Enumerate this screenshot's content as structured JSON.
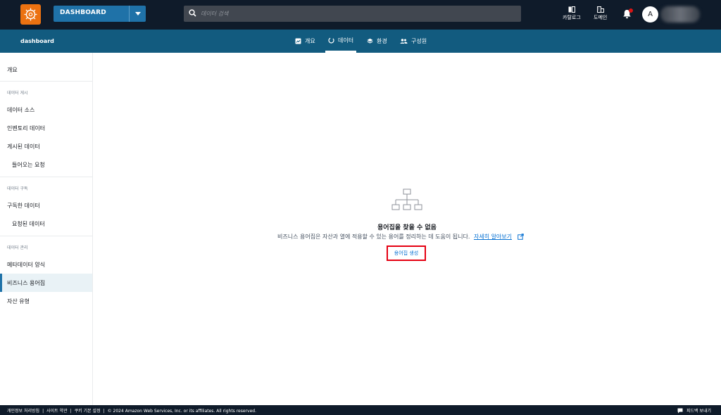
{
  "topbar": {
    "project_name": "DASHBOARD",
    "search_placeholder": "데이터 검색",
    "catalog_label": "카탈로그",
    "domain_label": "도메인",
    "avatar_initial": "A"
  },
  "subheader": {
    "project_title": "dashboard",
    "tabs": [
      {
        "label": "개요",
        "icon": "overview-icon",
        "active": false
      },
      {
        "label": "데이터",
        "icon": "data-icon",
        "active": true
      },
      {
        "label": "환경",
        "icon": "layers-icon",
        "active": false
      },
      {
        "label": "구성원",
        "icon": "members-icon",
        "active": false
      }
    ]
  },
  "sidebar": {
    "overview": "개요",
    "section_publish": "데이터 게시",
    "data_sources": "데이터 소스",
    "inventory_data": "인벤토리 데이터",
    "published_data": "게시된 데이터",
    "incoming_requests": "들어오는 요청",
    "section_subscribe": "데이터 구독",
    "subscribed_data": "구독한 데이터",
    "requested_data": "요청된 데이터",
    "section_manage": "데이터 관리",
    "metadata_forms": "메타데이터 양식",
    "business_glossary": "비즈니스 용어집",
    "asset_types": "자산 유형"
  },
  "main": {
    "empty_title": "용어집을 찾을 수 없음",
    "empty_description": "비즈니스 용어집은 자산과 열에 적용할 수 있는 용어를 정리하는 데 도움이 됩니다.",
    "learn_more_link": "자세히 알아보기",
    "create_button": "용어집 생성"
  },
  "footer": {
    "privacy": "개인정보 처리방침",
    "terms": "사이트 약관",
    "cookies": "쿠키 기본 설정",
    "copyright": "© 2024 Amazon Web Services, Inc. or its affiliates. All rights reserved.",
    "feedback": "피드백 보내기"
  },
  "colors": {
    "topbar_bg": "#0f1b2a",
    "subheader_bg": "#125b7f",
    "brand_orange": "#ec7211",
    "link_blue": "#0972d3",
    "highlight_red": "#e50012"
  }
}
